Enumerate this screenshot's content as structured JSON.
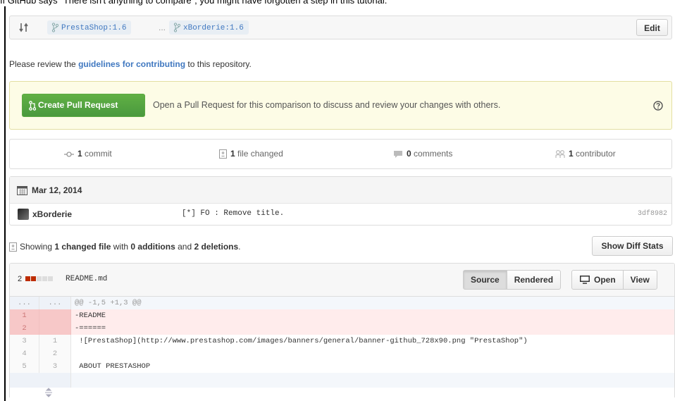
{
  "caption": "If GitHub says \"There isn't anything to compare\", you might have forgotten a step in this tutorial.",
  "range": {
    "base_branch": "PrestaShop:1.6",
    "separator": "...",
    "head_branch": "xBorderie:1.6",
    "edit_label": "Edit"
  },
  "guidelines": {
    "prefix": "Please review the ",
    "link": "guidelines for contributing",
    "suffix": " to this repository."
  },
  "flash": {
    "button_label": "Create Pull Request",
    "text": "Open a Pull Request for this comparison to discuss and review your changes with others."
  },
  "stats": {
    "commits_count": "1",
    "commits_label": " commit",
    "files_count": "1",
    "files_label": " file changed",
    "comments_count": "0",
    "comments_label": " comments",
    "contributors_count": "1",
    "contributors_label": " contributor"
  },
  "commit_group": {
    "date": "Mar 12, 2014",
    "commits": [
      {
        "author": "xBorderie",
        "message": "[*] FO : Remove title.",
        "sha": "3df8982"
      }
    ]
  },
  "summary": {
    "showing": "Showing ",
    "changed": "1 changed file",
    "with": " with ",
    "additions": "0 additions",
    "and": " and ",
    "deletions": "2 deletions",
    "period": ".",
    "diff_stats_label": "Show Diff Stats"
  },
  "file": {
    "changes": "2",
    "name": "README.md",
    "source_label": "Source",
    "rendered_label": "Rendered",
    "open_label": "Open",
    "view_label": "View",
    "lines": [
      {
        "type": "hunk",
        "old": "...",
        "new": "...",
        "text": "@@ -1,5 +1,3 @@"
      },
      {
        "type": "del",
        "old": "1",
        "new": "",
        "text": "-README"
      },
      {
        "type": "del",
        "old": "2",
        "new": "",
        "text": "-======"
      },
      {
        "type": "ctx",
        "old": "3",
        "new": "1",
        "text": " ![PrestaShop](http://www.prestashop.com/images/banners/general/banner-github_728x90.png \"PrestaShop\")"
      },
      {
        "type": "ctx",
        "old": "4",
        "new": "2",
        "text": " "
      },
      {
        "type": "ctx",
        "old": "5",
        "new": "3",
        "text": " ABOUT PRESTASHOP"
      }
    ]
  },
  "colors": {
    "accent_green": "#55a532",
    "link_blue": "#4078c0",
    "deletion_red": "#bd2c00",
    "deleted_line_bg": "#ffecec"
  }
}
